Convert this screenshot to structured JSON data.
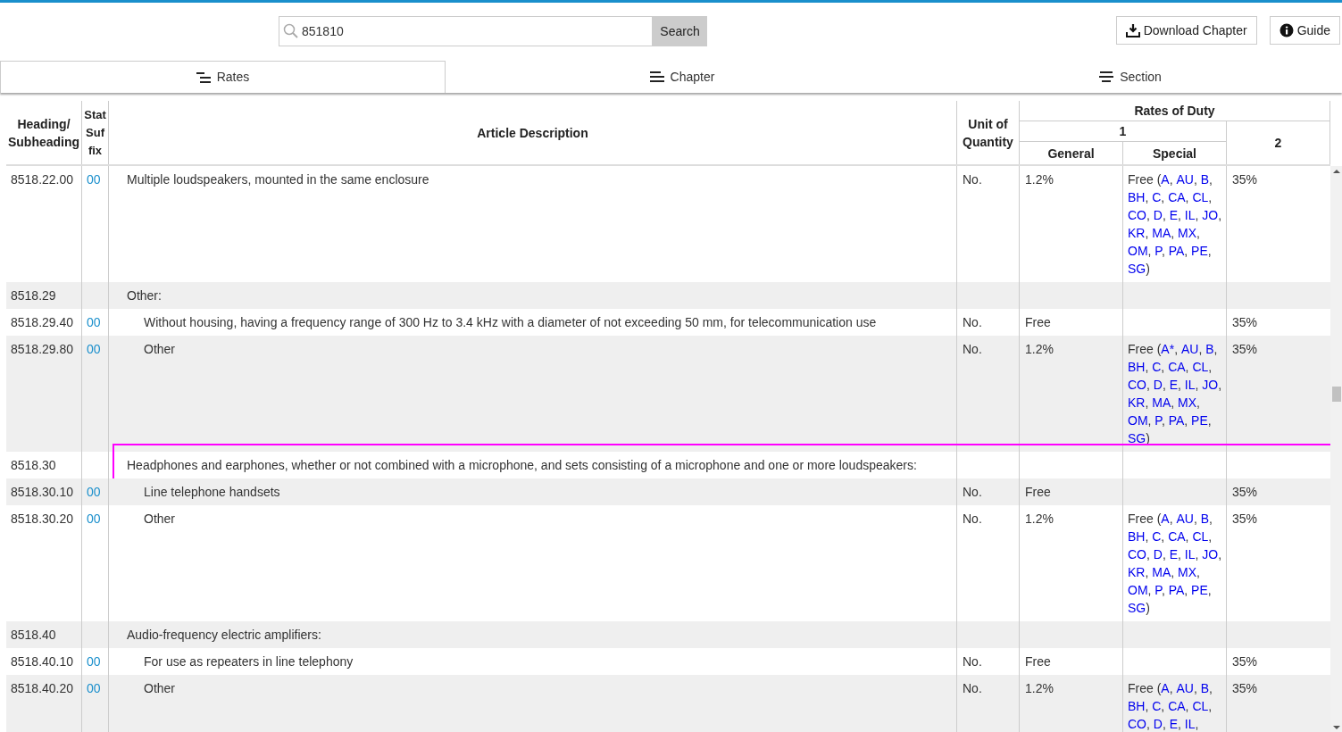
{
  "search": {
    "value": "851810",
    "button": "Search"
  },
  "actions": [
    {
      "kind": "download",
      "label": "Download Chapter"
    },
    {
      "kind": "info",
      "label": "Guide"
    }
  ],
  "tabs": [
    {
      "label": "Rates",
      "kind": "rates",
      "selected": true
    },
    {
      "label": "Chapter",
      "kind": "lines",
      "selected": false
    },
    {
      "label": "Section",
      "kind": "centered",
      "selected": false
    }
  ],
  "table": {
    "columns": {
      "heading": "Heading/ Subheading",
      "stat_suffix": "Stat Suf fix",
      "description": "Article Description",
      "unit": "Unit of Quantity",
      "rates_group": "Rates of Duty",
      "column_1": "1",
      "general": "General",
      "special": "Special",
      "column_2": "2"
    },
    "rows": [
      {
        "children": [
          {
            "heading": "8518.22.00",
            "suffix": "00",
            "description": "Multiple loudspeakers, mounted in the same enclosure",
            "unit": "No.",
            "general": "1.2%",
            "special": {
              "before": "Free (",
              "codes": [
                [
                  "A",
                  ", "
                ],
                [
                  "AU",
                  ", "
                ],
                [
                  "B",
                  ", "
                ],
                [
                  "BH",
                  ", "
                ],
                [
                  "C",
                  ", "
                ],
                [
                  "CA",
                  ", "
                ],
                [
                  "CL",
                  ", "
                ],
                [
                  "CO",
                  ", "
                ],
                [
                  "D",
                  ", "
                ],
                [
                  "E",
                  ", "
                ],
                [
                  "IL",
                  ", "
                ],
                [
                  "JO",
                  ", "
                ],
                [
                  "KR",
                  ", "
                ],
                [
                  "MA",
                  ", "
                ],
                [
                  "MX",
                  ", "
                ],
                [
                  "OM",
                  ", "
                ],
                [
                  "P",
                  ", "
                ],
                [
                  "PA",
                  ", "
                ],
                [
                  "PE",
                  ", "
                ],
                [
                  "SG",
                  ")"
                ]
              ]
            },
            "column_2": "35%",
            "highlighted": false
          },
          {
            "heading": "8518.29",
            "description": "Other:",
            "highlighted": false,
            "children": [
              {
                "heading": "8518.29.40",
                "suffix": "00",
                "description": "Without housing, having a frequency range of 300 Hz to 3.4 kHz with a diameter of not exceeding 50 mm, for telecommunication use",
                "unit": "No.",
                "general": "Free",
                "column_2": "35%",
                "highlighted": false
              },
              {
                "heading": "8518.29.80",
                "suffix": "00",
                "description": "Other",
                "unit": "No.",
                "general": "1.2%",
                "special": {
                  "before": "Free (",
                  "codes": [
                    [
                      "A*",
                      ", "
                    ],
                    [
                      "AU",
                      ", "
                    ],
                    [
                      "B",
                      ", "
                    ],
                    [
                      "BH",
                      ", "
                    ],
                    [
                      "C",
                      ", "
                    ],
                    [
                      "CA",
                      ", "
                    ],
                    [
                      "CL",
                      ", "
                    ],
                    [
                      "CO",
                      ", "
                    ],
                    [
                      "D",
                      ", "
                    ],
                    [
                      "E",
                      ", "
                    ],
                    [
                      "IL",
                      ", "
                    ],
                    [
                      "JO",
                      ", "
                    ],
                    [
                      "KR",
                      ", "
                    ],
                    [
                      "MA",
                      ", "
                    ],
                    [
                      "MX",
                      ", "
                    ],
                    [
                      "OM",
                      ", "
                    ],
                    [
                      "P",
                      ", "
                    ],
                    [
                      "PA",
                      ", "
                    ],
                    [
                      "PE",
                      ", "
                    ],
                    [
                      "SG",
                      ")"
                    ]
                  ]
                },
                "column_2": "35%",
                "highlighted": false
              }
            ]
          }
        ]
      },
      {
        "heading": "8518.30",
        "description": "Headphones and earphones, whether or not combined with a microphone, and sets consisting of a microphone and one or more loudspeakers:",
        "highlighted": true,
        "children": [
          {
            "heading": "8518.30.10",
            "suffix": "00",
            "description": "Line telephone handsets",
            "unit": "No.",
            "general": "Free",
            "column_2": "35%",
            "highlighted": false
          },
          {
            "heading": "8518.30.20",
            "suffix": "00",
            "description": "Other",
            "unit": "No.",
            "general": "1.2%",
            "special": {
              "before": "Free (",
              "codes": [
                [
                  "A",
                  ", "
                ],
                [
                  "AU",
                  ", "
                ],
                [
                  "B",
                  ", "
                ],
                [
                  "BH",
                  ", "
                ],
                [
                  "C",
                  ", "
                ],
                [
                  "CA",
                  ", "
                ],
                [
                  "CL",
                  ", "
                ],
                [
                  "CO",
                  ", "
                ],
                [
                  "D",
                  ", "
                ],
                [
                  "E",
                  ", "
                ],
                [
                  "IL",
                  ", "
                ],
                [
                  "JO",
                  ", "
                ],
                [
                  "KR",
                  ", "
                ],
                [
                  "MA",
                  ", "
                ],
                [
                  "MX",
                  ", "
                ],
                [
                  "OM",
                  ", "
                ],
                [
                  "P",
                  ", "
                ],
                [
                  "PA",
                  ", "
                ],
                [
                  "PE",
                  ", "
                ],
                [
                  "SG",
                  ")"
                ]
              ]
            },
            "column_2": "35%",
            "highlighted": false
          }
        ]
      },
      {
        "heading": "8518.40",
        "description": "Audio-frequency electric amplifiers:",
        "highlighted": false,
        "children": [
          {
            "heading": "8518.40.10",
            "suffix": "00",
            "description": "For use as repeaters in line telephony",
            "unit": "No.",
            "general": "Free",
            "column_2": "35%",
            "highlighted": false
          },
          {
            "heading": "8518.40.20",
            "suffix": "00",
            "description": "Other",
            "unit": "No.",
            "general": "1.2%",
            "special": {
              "before": "Free (",
              "codes": [
                [
                  "A",
                  ", "
                ],
                [
                  "AU",
                  ", "
                ],
                [
                  "B",
                  ", "
                ],
                [
                  "BH",
                  ", "
                ],
                [
                  "C",
                  ", "
                ],
                [
                  "CA",
                  ", "
                ],
                [
                  "CL",
                  ", "
                ],
                [
                  "CO",
                  ", "
                ],
                [
                  "D",
                  ", "
                ],
                [
                  "E",
                  ", "
                ],
                [
                  "IL",
                  ","
                ]
              ]
            },
            "column_2": "35%",
            "highlighted": false
          }
        ]
      }
    ]
  }
}
